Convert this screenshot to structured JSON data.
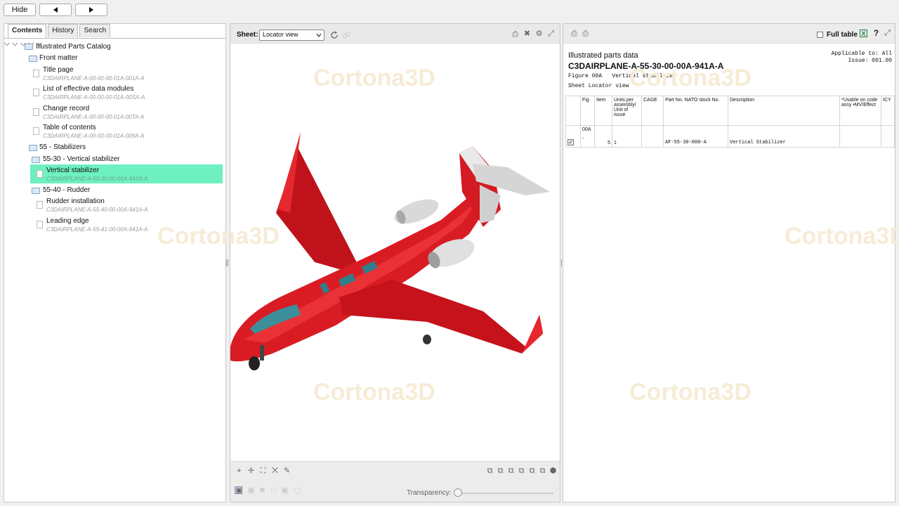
{
  "top": {
    "hide_label": "Hide",
    "back_icon": "back-arrow-icon",
    "forward_icon": "forward-arrow-icon"
  },
  "left_tabs": [
    "Contents",
    "History",
    "Search"
  ],
  "tree": {
    "root": "Illustrated Parts Catalog",
    "front_matter": "Front matter",
    "items": [
      {
        "label": "Title page",
        "code": "C3DAIRPLANE-A-00-00-00-01A-001A-A"
      },
      {
        "label": "List of effective data modules",
        "code": "C3DAIRPLANE-A-00-00-00-01A-00SA-A"
      },
      {
        "label": "Change record",
        "code": "C3DAIRPLANE-A-00-00-00-01A-00TA-A"
      },
      {
        "label": "Table of contents",
        "code": "C3DAIRPLANE-A-00-00-00-01A-009A-A"
      }
    ],
    "stabilizers": "55 - Stabilizers",
    "vstab": "55-30 - Vertical stabilizer",
    "vstab_item": {
      "label": "Vertical stabilizer",
      "code": "C3DAIRPLANE-A-55-30-00-00A-941A-A"
    },
    "rudder": "55-40 - Rudder",
    "rudder_items": [
      {
        "label": "Rudder installation",
        "code": "C3DAIRPLANE-A-55-40-00-00A-941A-A"
      },
      {
        "label": "Leading edge",
        "code": "C3DAIRPLANE-A-55-41-00-00A-941A-A"
      }
    ]
  },
  "viewer": {
    "sheet_label": "Sheet:",
    "sheet_value": "Locator view",
    "transparency_label": "Transparency:",
    "watermark": "Cortona3D",
    "transparency_value": 0
  },
  "ipd": {
    "full_table_label": "Full table",
    "heading": "Illustrated parts data",
    "dmc": "C3DAIRPLANE-A-55-30-00-00A-941A-A",
    "applicable": "Applicable to: All",
    "issue": "Issue: 001.00",
    "figure": "Figure 00A   Vertical stabilizer",
    "sheet": "Sheet Locator view",
    "columns": [
      "Fig",
      "Item",
      "Units per assembly/ Unit of issue",
      "CAGE",
      "Part No. NATO stock No.",
      "Description",
      "*Usable on code assy •MV/Effect",
      "ICY"
    ],
    "row": {
      "fig_top": "00A",
      "fig": "-",
      "item": "5",
      "units": "1",
      "cage": "",
      "part": "AF-55-30-000-A",
      "desc": "Vertical Stabilizer",
      "usable": "",
      "icy": ""
    }
  }
}
